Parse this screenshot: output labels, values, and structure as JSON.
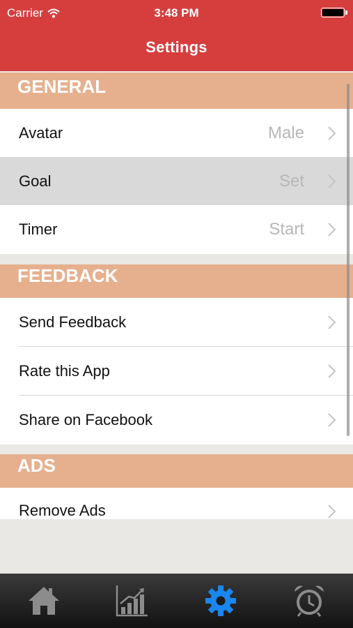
{
  "status_bar": {
    "carrier": "Carrier",
    "time": "3:48 PM"
  },
  "nav": {
    "title": "Settings"
  },
  "sections": {
    "general": {
      "header": "GENERAL",
      "rows": [
        {
          "label": "Avatar",
          "detail": "Male"
        },
        {
          "label": "Goal",
          "detail": "Set"
        },
        {
          "label": "Timer",
          "detail": "Start"
        }
      ]
    },
    "feedback": {
      "header": "FEEDBACK",
      "rows": [
        {
          "label": "Send Feedback"
        },
        {
          "label": "Rate this App"
        },
        {
          "label": "Share on Facebook"
        }
      ]
    },
    "ads": {
      "header": "ADS",
      "rows": [
        {
          "label": "Remove Ads"
        }
      ]
    }
  },
  "tabbar": {
    "items": [
      {
        "icon": "home-icon",
        "selected": false
      },
      {
        "icon": "chart-icon",
        "selected": false
      },
      {
        "icon": "gear-icon",
        "selected": true
      },
      {
        "icon": "alarm-clock-icon",
        "selected": false
      }
    ]
  },
  "colors": {
    "header_bg": "#d63e3e",
    "section_bg": "#e6b08e",
    "selected_row_bg": "#d9d9d9",
    "tab_active": "#1a86f0",
    "tab_inactive": "#8c8c8c"
  }
}
